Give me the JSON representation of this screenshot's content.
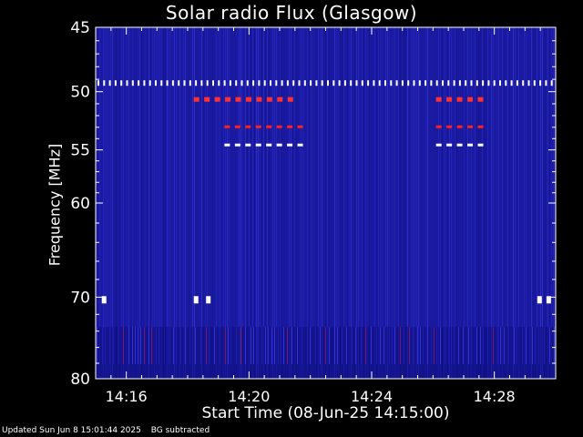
{
  "chart_data": {
    "type": "heatmap",
    "title": "Solar radio Flux (Glasgow)",
    "xlabel": "Start Time (08-Jun-25 14:15:00)",
    "ylabel": "Frequency [MHz]",
    "x_ticks": [
      "14:16",
      "14:20",
      "14:24",
      "14:28"
    ],
    "x_tick_minutes": [
      1,
      5,
      9,
      13
    ],
    "xlim_minutes": [
      0,
      15
    ],
    "y_ticks": [
      45,
      50,
      55,
      60,
      70,
      80
    ],
    "ylim": [
      80,
      45
    ],
    "y_scale": "log",
    "background_colors": [
      "#1a1aa0",
      "#2a2ad0",
      "#3c3ce8",
      "#101080"
    ],
    "interference_bands_mhz": [
      {
        "freq": 49.3,
        "color": "#ffffff",
        "style": "dotted"
      },
      {
        "freq": 50.6,
        "color": "#ff3030",
        "style": "dashed"
      },
      {
        "freq": 53.0,
        "color": "#ff2020",
        "style": "dashed"
      },
      {
        "freq": 54.6,
        "color": "#ffffff",
        "style": "dashed"
      },
      {
        "freq": 70.3,
        "color": "#ffffff",
        "style": "spots"
      }
    ]
  },
  "footer": {
    "updated": "Updated Sun Jun  8 15:01:44 2025",
    "note": "BG subtracted"
  }
}
